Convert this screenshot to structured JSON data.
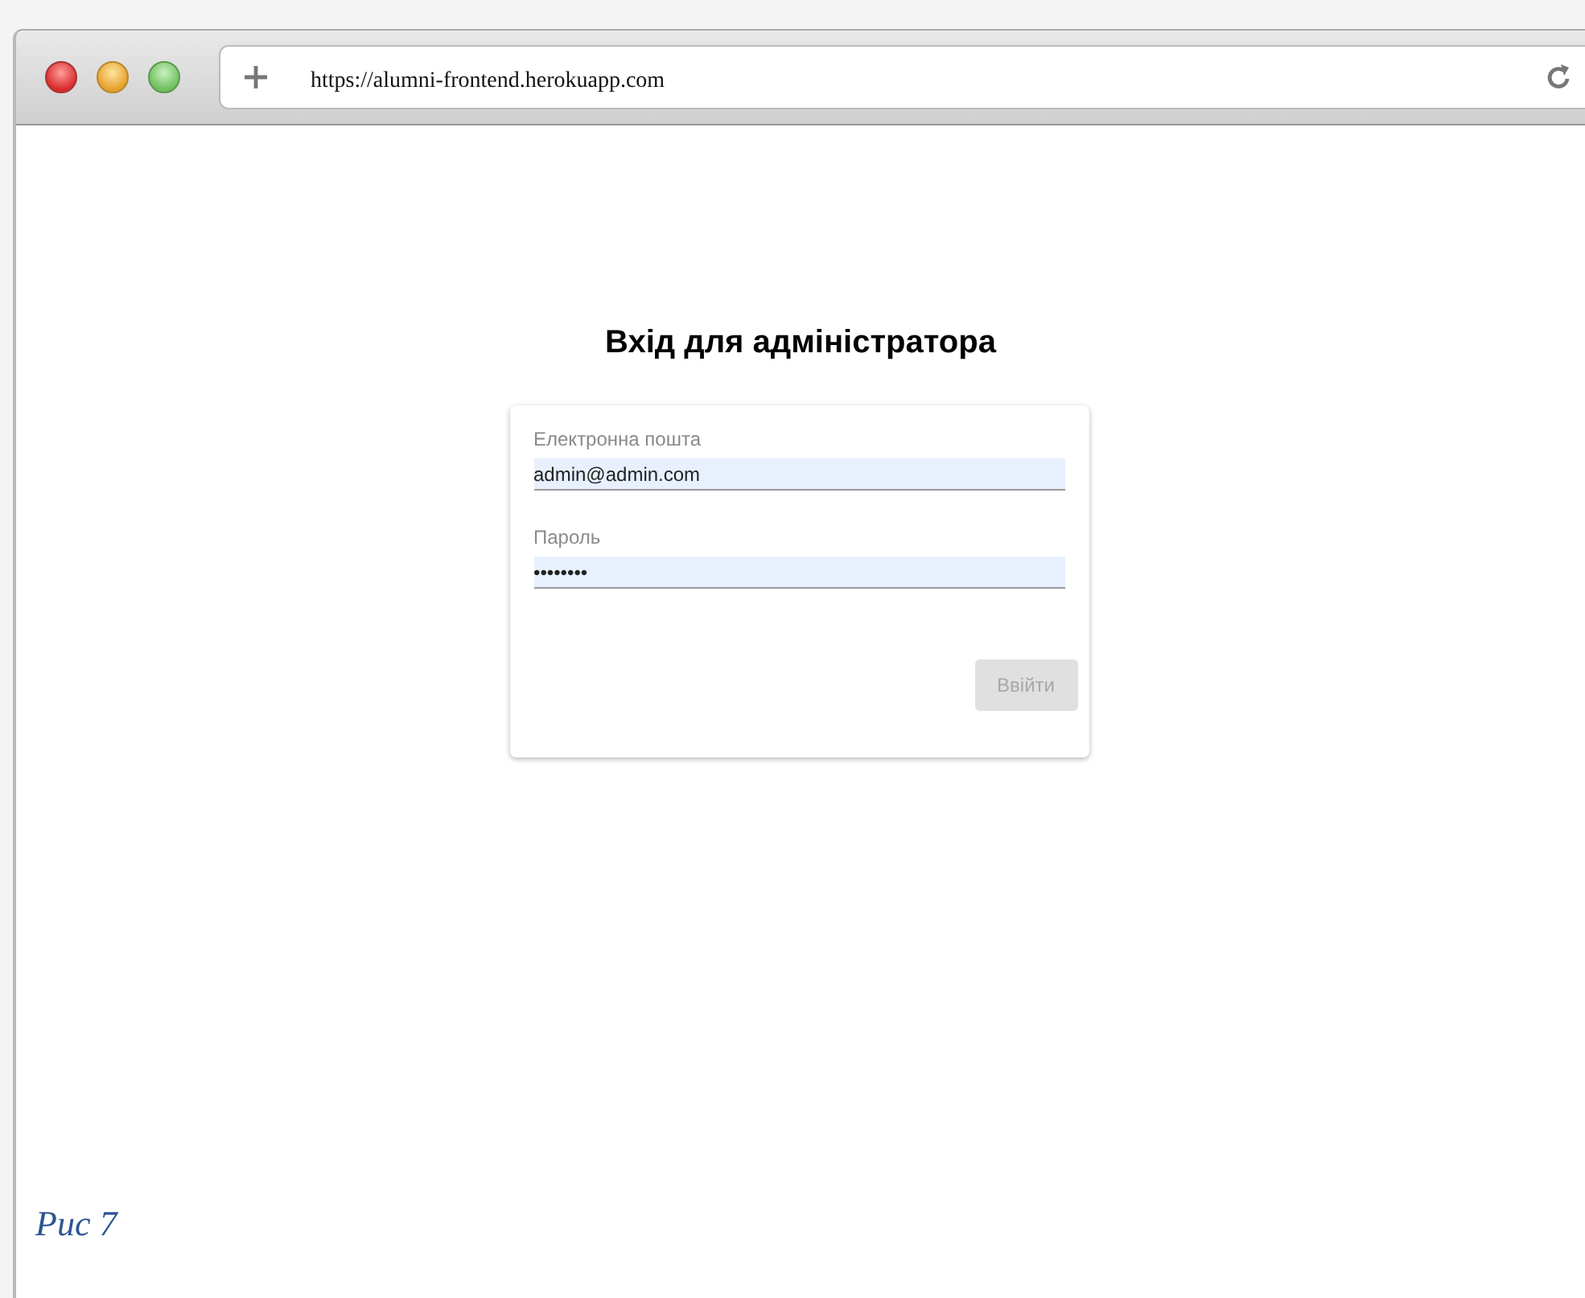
{
  "browser": {
    "url": "https://alumni-frontend.herokuapp.com"
  },
  "page": {
    "title": "Вхід для адміністратора",
    "fields": [
      {
        "label": "Електронна пошта",
        "value": "admin@admin.com",
        "autofilled": true
      },
      {
        "label": "Пароль",
        "value": "••••••••",
        "autofilled": true
      }
    ],
    "button": {
      "label": "Ввійти",
      "disabled": true
    }
  },
  "caption": "Рис 7"
}
